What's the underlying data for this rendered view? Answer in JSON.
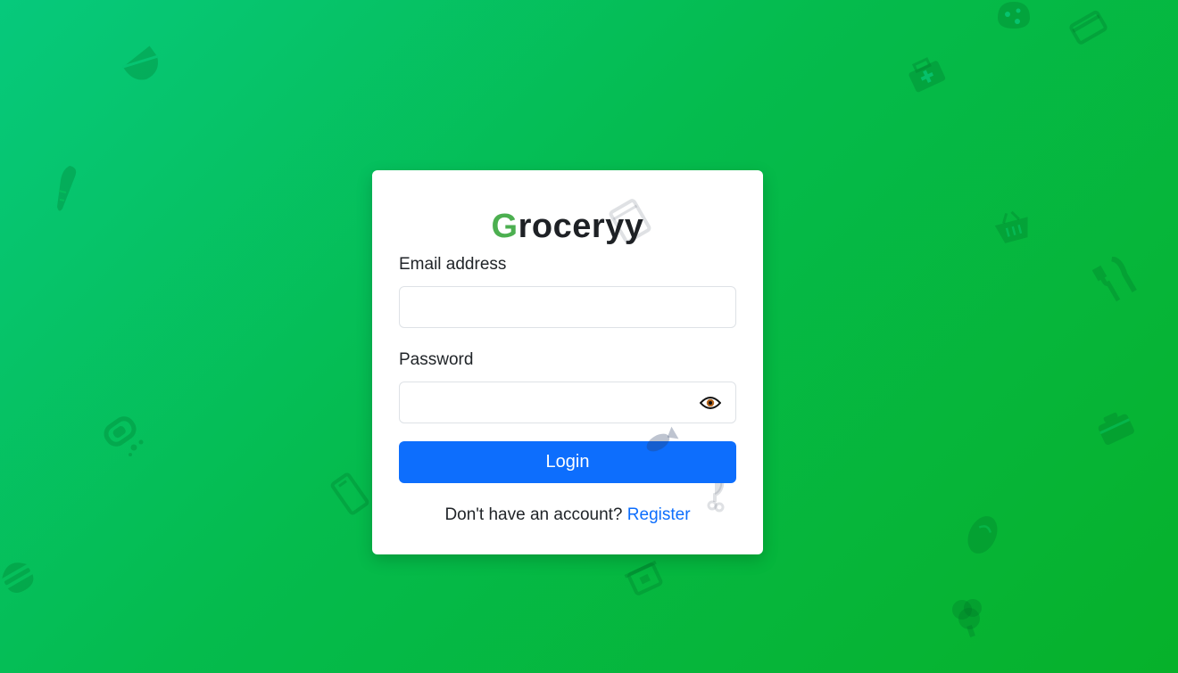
{
  "brand": {
    "first_letter": "G",
    "rest": "roceryy",
    "accent_color": "#4caf50"
  },
  "form": {
    "email_label": "Email address",
    "email_value": "",
    "password_label": "Password",
    "password_value": "",
    "password_toggle_icon": "eye-icon",
    "login_label": "Login",
    "footer_prompt": "Don't have an account?",
    "register_link": "Register"
  },
  "colors": {
    "primary_button": "#0d6efd",
    "link": "#0d6efd",
    "background_start": "#06c97c",
    "background_end": "#06b12a"
  },
  "background_icons": [
    "cheese-icon",
    "wallet-icon",
    "first-aid-kit-icon",
    "cheese-wedge-icon",
    "carrot-icon",
    "shopping-basket-icon",
    "cutlery-icon",
    "soap-icon",
    "lunchbox-icon",
    "phone-icon",
    "burger-icon",
    "pot-icon",
    "lemon-icon",
    "broccoli-icon",
    "tablet-icon",
    "bottle-icon",
    "fish-icon",
    "chicken-leg-icon"
  ]
}
